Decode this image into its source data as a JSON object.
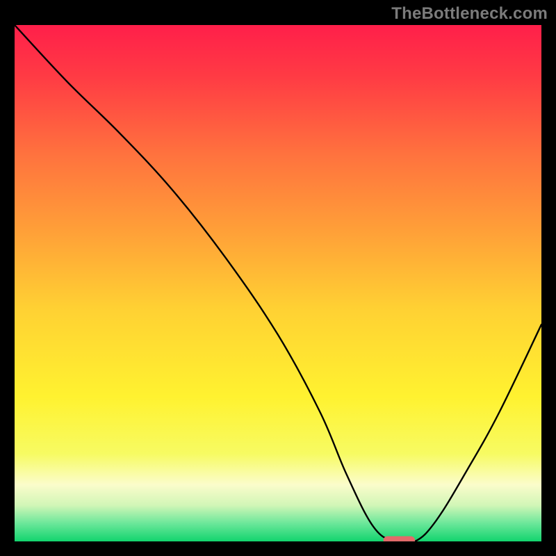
{
  "attribution": "TheBottleneck.com",
  "colors": {
    "frame": "#000000",
    "curve": "#000000",
    "marker_fill": "#e26a6a",
    "marker_stroke": "#b84f4f"
  },
  "chart_data": {
    "type": "line",
    "title": "",
    "xlabel": "",
    "ylabel": "",
    "xlim": [
      0,
      100
    ],
    "ylim": [
      0,
      100
    ],
    "grid": false,
    "legend": false,
    "background_gradient": {
      "direction": "vertical",
      "stops": [
        {
          "pos": 0.0,
          "color": "#ff1f4a"
        },
        {
          "pos": 0.1,
          "color": "#ff3b44"
        },
        {
          "pos": 0.25,
          "color": "#ff723e"
        },
        {
          "pos": 0.4,
          "color": "#ffa038"
        },
        {
          "pos": 0.55,
          "color": "#ffd133"
        },
        {
          "pos": 0.72,
          "color": "#fff230"
        },
        {
          "pos": 0.83,
          "color": "#f7fb62"
        },
        {
          "pos": 0.89,
          "color": "#fbfccb"
        },
        {
          "pos": 0.93,
          "color": "#d2f6b7"
        },
        {
          "pos": 0.965,
          "color": "#6be79a"
        },
        {
          "pos": 1.0,
          "color": "#12d46e"
        }
      ]
    },
    "series": [
      {
        "name": "bottleneck-curve",
        "x": [
          0,
          10,
          20,
          30,
          40,
          50,
          58,
          63,
          68,
          72,
          76,
          80,
          86,
          92,
          100
        ],
        "y": [
          100,
          89,
          79,
          68,
          55,
          40,
          25,
          13,
          3,
          0,
          0,
          4,
          14,
          25,
          42
        ]
      }
    ],
    "annotations": [
      {
        "name": "optimal-marker",
        "shape": "capsule",
        "x_range": [
          70,
          76
        ],
        "y": 0.2
      }
    ]
  }
}
